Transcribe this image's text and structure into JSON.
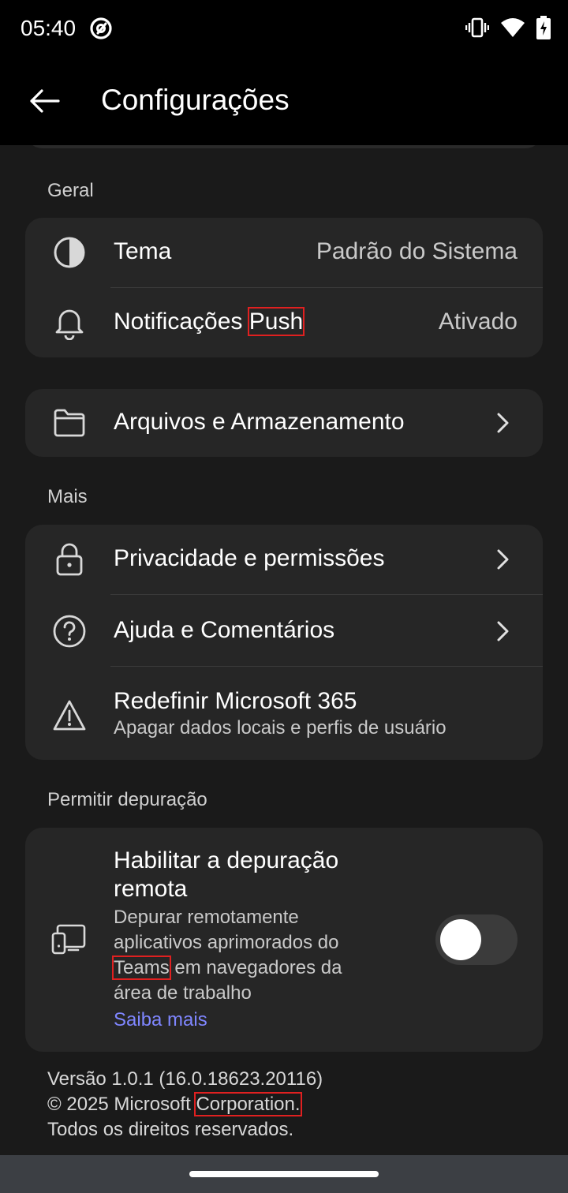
{
  "status_bar": {
    "time": "05:40",
    "icons": [
      "at-sign-icon",
      "vibrate-icon",
      "wifi-icon",
      "battery-charging-icon"
    ]
  },
  "app_bar": {
    "title": "Configurações",
    "back_icon": "arrow-left-icon"
  },
  "sections": {
    "geral": {
      "label": "Geral",
      "tema_label": "Tema",
      "tema_value": "Padrão do Sistema",
      "notif_label_a": "Notificações ",
      "notif_label_b": "Push",
      "notif_value": "Ativado"
    },
    "arquivos": {
      "label": "Arquivos e Armazenamento"
    },
    "mais": {
      "label": "Mais",
      "privacy_label": "Privacidade e permissões",
      "help_label": "Ajuda e Comentários",
      "reset_label": "Redefinir Microsoft 365",
      "reset_sub": "Apagar dados locais e perfis de usuário"
    },
    "debug": {
      "label": "Permitir depuração",
      "title_line1": "Habilitar a depuração",
      "title_line2": "remota",
      "desc_line1": "Depurar remotamente",
      "desc_line2": "aplicativos aprimorados do",
      "desc_line3_a": "Teams",
      "desc_line3_b": " em navegadores da",
      "desc_line4": "área de trabalho",
      "link": "Saiba mais",
      "toggle_on": false
    }
  },
  "footer": {
    "version": "Versão 1.0.1 (16.0.18623.20116)",
    "copyright_a": "© 2025 Microsoft ",
    "copyright_b": "Corporation.",
    "rights": "Todos os direitos reservados."
  },
  "colors": {
    "background": "#1a1a1a",
    "card": "#262626",
    "link": "#7f86ff",
    "highlight": "#e02020"
  }
}
